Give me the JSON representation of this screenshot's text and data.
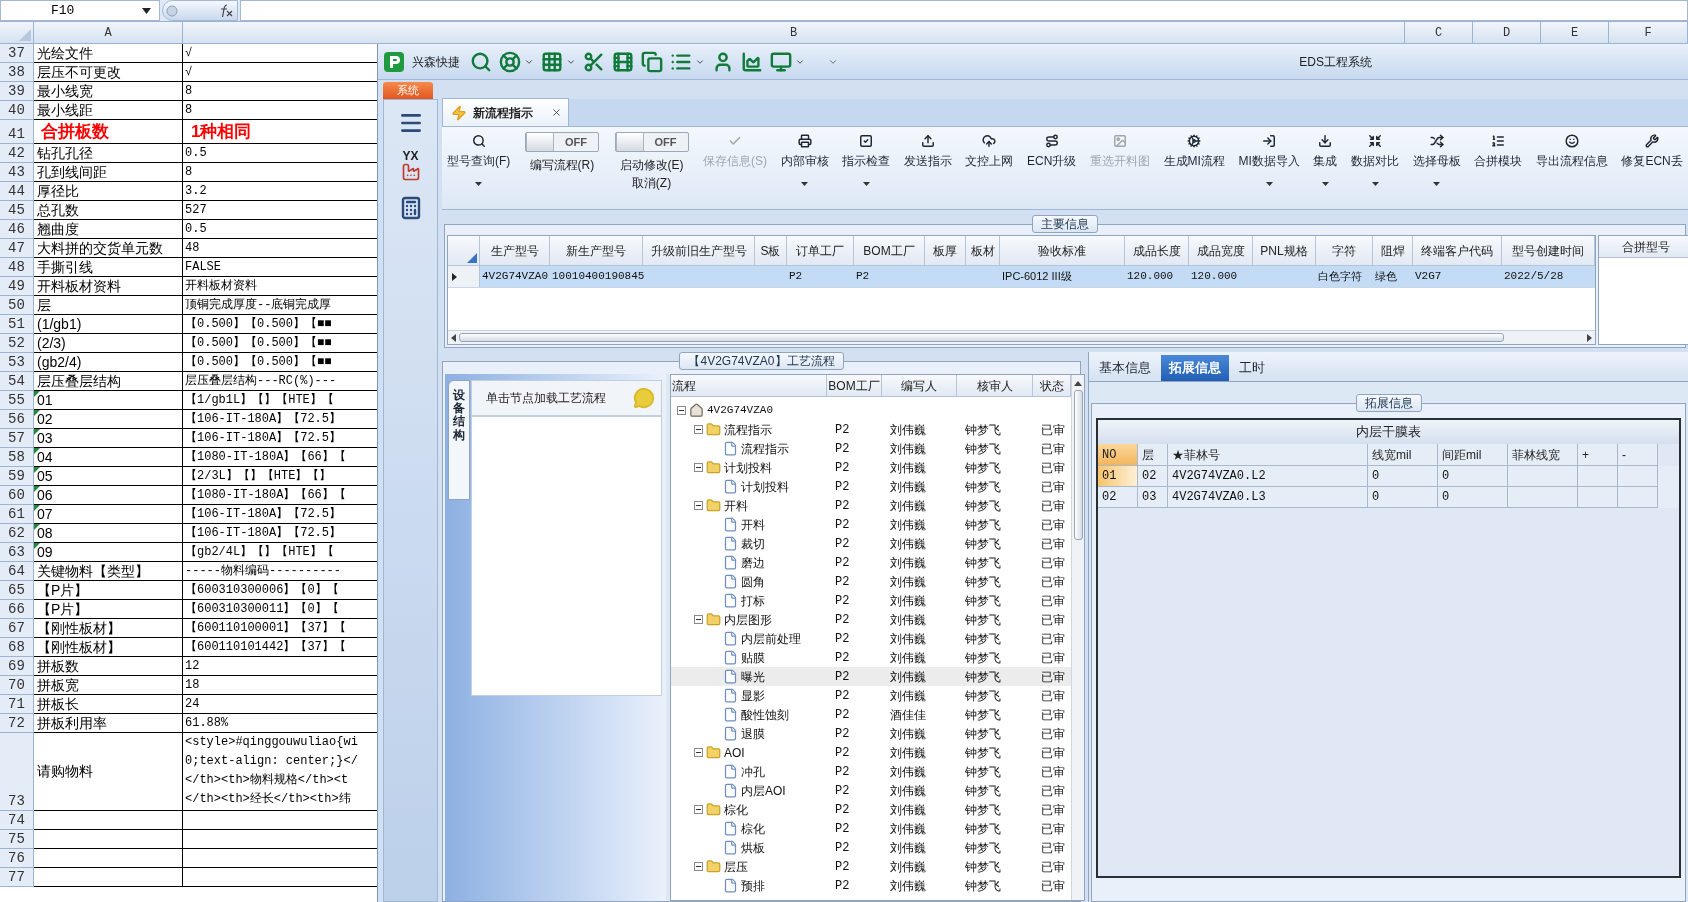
{
  "spreadsheet": {
    "name_box": "F10",
    "column_headers": [
      "A",
      "B",
      "C",
      "D",
      "E",
      "F"
    ],
    "rows": [
      {
        "number": "37",
        "a": "光绘文件",
        "b": "√",
        "kind": "normal",
        "flag": false
      },
      {
        "number": "38",
        "a": "层压不可更改",
        "b": "√",
        "kind": "normal",
        "flag": false
      },
      {
        "number": "39",
        "a": "最小线宽",
        "b": "8",
        "kind": "normal",
        "flag": false
      },
      {
        "number": "40",
        "a": "最小线距",
        "b": "8",
        "kind": "normal",
        "flag": false
      },
      {
        "number": "41",
        "a": "合拼板数",
        "b": "1种相同",
        "kind": "emphasis",
        "flag": false
      },
      {
        "number": "42",
        "a": "钻孔孔径",
        "b": "0.5",
        "kind": "normal",
        "flag": false
      },
      {
        "number": "43",
        "a": "孔到线间距",
        "b": "8",
        "kind": "normal",
        "flag": false
      },
      {
        "number": "44",
        "a": "厚径比",
        "b": "3.2",
        "kind": "normal",
        "flag": false
      },
      {
        "number": "45",
        "a": "总孔数",
        "b": "527",
        "kind": "normal",
        "flag": false
      },
      {
        "number": "46",
        "a": "翘曲度",
        "b": "0.5",
        "kind": "normal",
        "flag": false
      },
      {
        "number": "47",
        "a": "大料拼的交货单元数",
        "b": "48",
        "kind": "normal",
        "flag": false
      },
      {
        "number": "48",
        "a": "手撕引线",
        "b": "FALSE",
        "kind": "normal",
        "flag": false
      },
      {
        "number": "49",
        "a": "开料板材资料",
        "b": "开料板材资料",
        "kind": "normal",
        "flag": false
      },
      {
        "number": "50",
        "a": "层",
        "b": "顶铜完成厚度--底铜完成厚",
        "kind": "normal",
        "flag": false
      },
      {
        "number": "51",
        "a": "(1/gb1)",
        "b": "【0.500】【0.500】【■■",
        "kind": "normal",
        "flag": false
      },
      {
        "number": "52",
        "a": "(2/3)",
        "b": "【0.500】【0.500】【■■",
        "kind": "normal",
        "flag": false
      },
      {
        "number": "53",
        "a": "(gb2/4)",
        "b": "【0.500】【0.500】【■■",
        "kind": "normal",
        "flag": false
      },
      {
        "number": "54",
        "a": "层压叠层结构",
        "b": "层压叠层结构---RC(%)---",
        "kind": "normal",
        "flag": false
      },
      {
        "number": "55",
        "a": "01",
        "b": "【1/gb1L】【】【HTE】【",
        "kind": "normal",
        "flag": true
      },
      {
        "number": "56",
        "a": "02",
        "b": "【106-IT-180A】【72.5】",
        "kind": "normal",
        "flag": true
      },
      {
        "number": "57",
        "a": "03",
        "b": "【106-IT-180A】【72.5】",
        "kind": "normal",
        "flag": true
      },
      {
        "number": "58",
        "a": "04",
        "b": "【1080-IT-180A】【66】【",
        "kind": "normal",
        "flag": true
      },
      {
        "number": "59",
        "a": "05",
        "b": "【2/3L】【】【HTE】【】",
        "kind": "normal",
        "flag": true
      },
      {
        "number": "60",
        "a": "06",
        "b": "【1080-IT-180A】【66】【",
        "kind": "normal",
        "flag": true
      },
      {
        "number": "61",
        "a": "07",
        "b": "【106-IT-180A】【72.5】",
        "kind": "normal",
        "flag": true
      },
      {
        "number": "62",
        "a": "08",
        "b": "【106-IT-180A】【72.5】",
        "kind": "normal",
        "flag": true
      },
      {
        "number": "63",
        "a": "09",
        "b": "【gb2/4L】【】【HTE】【",
        "kind": "normal",
        "flag": true
      },
      {
        "number": "64",
        "a": "关键物料【类型】",
        "b": "-----物料编码----------",
        "kind": "normal",
        "flag": false
      },
      {
        "number": "65",
        "a": "【P片】",
        "b": "【600310300006】【0】【",
        "kind": "normal",
        "flag": false
      },
      {
        "number": "66",
        "a": "【P片】",
        "b": "【600310300011】【0】【",
        "kind": "normal",
        "flag": false
      },
      {
        "number": "67",
        "a": "【刚性板材】",
        "b": "【600110100001】【37】【",
        "kind": "normal",
        "flag": false
      },
      {
        "number": "68",
        "a": "【刚性板材】",
        "b": "【600110101442】【37】【",
        "kind": "normal",
        "flag": false
      },
      {
        "number": "69",
        "a": "拼板数",
        "b": "12",
        "kind": "normal",
        "flag": false
      },
      {
        "number": "70",
        "a": "拼板宽",
        "b": "18",
        "kind": "normal",
        "flag": false
      },
      {
        "number": "71",
        "a": "拼板长",
        "b": "24",
        "kind": "normal",
        "flag": false
      },
      {
        "number": "72",
        "a": "拼板利用率",
        "b": "61.88%",
        "kind": "normal",
        "flag": false
      },
      {
        "number": "73",
        "a": "请购物料",
        "b": "<style>#qinggouwuliao{wi\n0;text-align: center;}</\n</th><th>物料规格</th><t\n</th><th>经长</th><th>纬",
        "kind": "tall",
        "flag": false
      },
      {
        "number": "74",
        "kind": "normal",
        "flag": false
      },
      {
        "number": "75",
        "kind": "normal",
        "flag": false
      },
      {
        "number": "76",
        "kind": "normal",
        "flag": false
      },
      {
        "number": "77",
        "kind": "normal",
        "flag": false
      }
    ]
  },
  "window": {
    "title": "EDS工程系统",
    "app_name": "兴森快捷",
    "app_menu": "系统"
  },
  "nav": [
    {
      "kind": "menu"
    },
    {
      "kind": "factory",
      "label": "YX"
    },
    {
      "kind": "calculator"
    }
  ],
  "doc_tab": {
    "label": "新流程指示",
    "selected": true
  },
  "ribbon": {
    "items": [
      {
        "kind": "button",
        "label": "型号查询(F)",
        "disabled": false,
        "menu": true
      },
      {
        "kind": "toggle",
        "label": "编写流程(R)",
        "switch_text": "OFF",
        "on": false
      },
      {
        "kind": "toggle",
        "label": "启动修改(E)",
        "sublabel": "取消(Z)",
        "switch_text": "OFF",
        "on": false
      },
      {
        "kind": "button",
        "label": "保存信息(S)",
        "disabled": true,
        "menu": false
      },
      {
        "kind": "button",
        "label": "内部审核",
        "disabled": false,
        "menu": true
      },
      {
        "kind": "button",
        "label": "指示检查",
        "disabled": false,
        "menu": true
      },
      {
        "kind": "button",
        "label": "发送指示",
        "disabled": false,
        "menu": false
      },
      {
        "kind": "button",
        "label": "文控上网",
        "disabled": false,
        "menu": false
      },
      {
        "kind": "button",
        "label": "ECN升级",
        "disabled": false,
        "menu": false
      },
      {
        "kind": "button",
        "label": "重选开料图",
        "disabled": true,
        "menu": false
      },
      {
        "kind": "button",
        "label": "生成MI流程",
        "disabled": false,
        "menu": false
      },
      {
        "kind": "button",
        "label": "MI数据导入",
        "disabled": false,
        "menu": true
      },
      {
        "kind": "button",
        "label": "集成",
        "disabled": false,
        "menu": true
      },
      {
        "kind": "button",
        "label": "数据对比",
        "disabled": false,
        "menu": true
      },
      {
        "kind": "button",
        "label": "选择母板",
        "disabled": false,
        "menu": true
      },
      {
        "kind": "button",
        "label": "合拼模块",
        "disabled": false,
        "menu": false
      },
      {
        "kind": "button",
        "label": "导出流程信息",
        "disabled": false,
        "menu": false
      },
      {
        "kind": "button",
        "label": "修复ECN丢",
        "disabled": false,
        "menu": false
      }
    ]
  },
  "main_info": {
    "title": "主要信息",
    "side_column": "合拼型号",
    "columns": [
      "生产型号",
      "新生产型号",
      "升级前旧生产型号",
      "S板",
      "订单工厂",
      "BOM工厂",
      "板厚",
      "板材",
      "验收标准",
      "成品长度",
      "成品宽度",
      "PNL规格",
      "字符",
      "阻焊",
      "终端客户代码",
      "型号创建时间"
    ],
    "rows": [
      {
        "selected": true,
        "cells": [
          "4V2G74VZA0",
          "10010400190845",
          null,
          null,
          "P2",
          "P2",
          null,
          null,
          "IPC-6012 III级",
          "120.000",
          "120.000",
          null,
          "白色字符",
          "绿色",
          "V2G7",
          "2022/5/28"
        ]
      }
    ]
  },
  "process": {
    "title": "【4V2G74VZA0】工艺流程",
    "side_tab": {
      "label": "设备结构",
      "selected": true
    },
    "hint": "单击节点加载工艺流程",
    "columns": [
      "流程",
      "BOM工厂",
      "编写人",
      "核审人",
      "状态"
    ],
    "tree": [
      {
        "kind": "root",
        "label": "4V2G74VZA0",
        "expanded": true,
        "selected": false,
        "children": [
          {
            "kind": "folder",
            "label": "流程指示",
            "bom": "P2",
            "writer": "刘伟巍",
            "reviewer": "钟梦飞",
            "status": "已审",
            "expanded": true,
            "selected": false,
            "children": [
              {
                "kind": "step",
                "label": "流程指示",
                "bom": "P2",
                "writer": "刘伟巍",
                "reviewer": "钟梦飞",
                "status": "已审",
                "selected": false
              }
            ]
          },
          {
            "kind": "folder",
            "label": "计划投料",
            "bom": "P2",
            "writer": "刘伟巍",
            "reviewer": "钟梦飞",
            "status": "已审",
            "expanded": true,
            "selected": false,
            "children": [
              {
                "kind": "step",
                "label": "计划投料",
                "bom": "P2",
                "writer": "刘伟巍",
                "reviewer": "钟梦飞",
                "status": "已审",
                "selected": false
              }
            ]
          },
          {
            "kind": "folder",
            "label": "开料",
            "bom": "P2",
            "writer": "刘伟巍",
            "reviewer": "钟梦飞",
            "status": "已审",
            "expanded": true,
            "selected": false,
            "children": [
              {
                "kind": "step",
                "label": "开料",
                "bom": "P2",
                "writer": "刘伟巍",
                "reviewer": "钟梦飞",
                "status": "已审",
                "selected": false
              },
              {
                "kind": "step",
                "label": "裁切",
                "bom": "P2",
                "writer": "刘伟巍",
                "reviewer": "钟梦飞",
                "status": "已审",
                "selected": false
              },
              {
                "kind": "step",
                "label": "磨边",
                "bom": "P2",
                "writer": "刘伟巍",
                "reviewer": "钟梦飞",
                "status": "已审",
                "selected": false
              },
              {
                "kind": "step",
                "label": "圆角",
                "bom": "P2",
                "writer": "刘伟巍",
                "reviewer": "钟梦飞",
                "status": "已审",
                "selected": false
              },
              {
                "kind": "step",
                "label": "打标",
                "bom": "P2",
                "writer": "刘伟巍",
                "reviewer": "钟梦飞",
                "status": "已审",
                "selected": false
              }
            ]
          },
          {
            "kind": "folder",
            "label": "内层图形",
            "bom": "P2",
            "writer": "刘伟巍",
            "reviewer": "钟梦飞",
            "status": "已审",
            "expanded": true,
            "selected": false,
            "children": [
              {
                "kind": "step",
                "label": "内层前处理",
                "bom": "P2",
                "writer": "刘伟巍",
                "reviewer": "钟梦飞",
                "status": "已审",
                "selected": false
              },
              {
                "kind": "step",
                "label": "贴膜",
                "bom": "P2",
                "writer": "刘伟巍",
                "reviewer": "钟梦飞",
                "status": "已审",
                "selected": false
              },
              {
                "kind": "step",
                "label": "曝光",
                "bom": "P2",
                "writer": "刘伟巍",
                "reviewer": "钟梦飞",
                "status": "已审",
                "selected": true
              },
              {
                "kind": "step",
                "label": "显影",
                "bom": "P2",
                "writer": "刘伟巍",
                "reviewer": "钟梦飞",
                "status": "已审",
                "selected": false
              },
              {
                "kind": "step",
                "label": "酸性蚀刻",
                "bom": "P2",
                "writer": "酒佳佳",
                "reviewer": "钟梦飞",
                "status": "已审",
                "selected": false
              },
              {
                "kind": "step",
                "label": "退膜",
                "bom": "P2",
                "writer": "刘伟巍",
                "reviewer": "钟梦飞",
                "status": "已审",
                "selected": false
              }
            ]
          },
          {
            "kind": "folder",
            "label": "AOI",
            "bom": "P2",
            "writer": "刘伟巍",
            "reviewer": "钟梦飞",
            "status": "已审",
            "expanded": true,
            "selected": false,
            "children": [
              {
                "kind": "step",
                "label": "冲孔",
                "bom": "P2",
                "writer": "刘伟巍",
                "reviewer": "钟梦飞",
                "status": "已审",
                "selected": false
              },
              {
                "kind": "step",
                "label": "内层AOI",
                "bom": "P2",
                "writer": "刘伟巍",
                "reviewer": "钟梦飞",
                "status": "已审",
                "selected": false
              }
            ]
          },
          {
            "kind": "folder",
            "label": "棕化",
            "bom": "P2",
            "writer": "刘伟巍",
            "reviewer": "钟梦飞",
            "status": "已审",
            "expanded": true,
            "selected": false,
            "children": [
              {
                "kind": "step",
                "label": "棕化",
                "bom": "P2",
                "writer": "刘伟巍",
                "reviewer": "钟梦飞",
                "status": "已审",
                "selected": false
              },
              {
                "kind": "step",
                "label": "烘板",
                "bom": "P2",
                "writer": "刘伟巍",
                "reviewer": "钟梦飞",
                "status": "已审",
                "selected": false
              }
            ]
          },
          {
            "kind": "folder",
            "label": "层压",
            "bom": "P2",
            "writer": "刘伟巍",
            "reviewer": "钟梦飞",
            "status": "已审",
            "expanded": true,
            "selected": false,
            "children": [
              {
                "kind": "step",
                "label": "预排",
                "bom": "P2",
                "writer": "刘伟巍",
                "reviewer": "钟梦飞",
                "status": "已审",
                "selected": false
              }
            ]
          }
        ]
      }
    ]
  },
  "detail": {
    "tabs": [
      {
        "label": "基本信息",
        "selected": false
      },
      {
        "label": "拓展信息",
        "selected": true
      },
      {
        "label": "工时",
        "selected": false
      }
    ],
    "group_title": "拓展信息",
    "table": {
      "caption": "内层干膜表",
      "columns": [
        "NO",
        "层",
        "★菲林号",
        "线宽mil",
        "间距mil",
        "菲林线宽",
        "+",
        "-"
      ],
      "rows": [
        {
          "selected": true,
          "cells": [
            "01",
            "02",
            "4V2G74VZA0.L2",
            "0",
            "0",
            null,
            null,
            null
          ]
        },
        {
          "selected": false,
          "cells": [
            "02",
            "03",
            "4V2G74VZA0.L3",
            "0",
            "0",
            null,
            null,
            null
          ]
        }
      ]
    }
  }
}
